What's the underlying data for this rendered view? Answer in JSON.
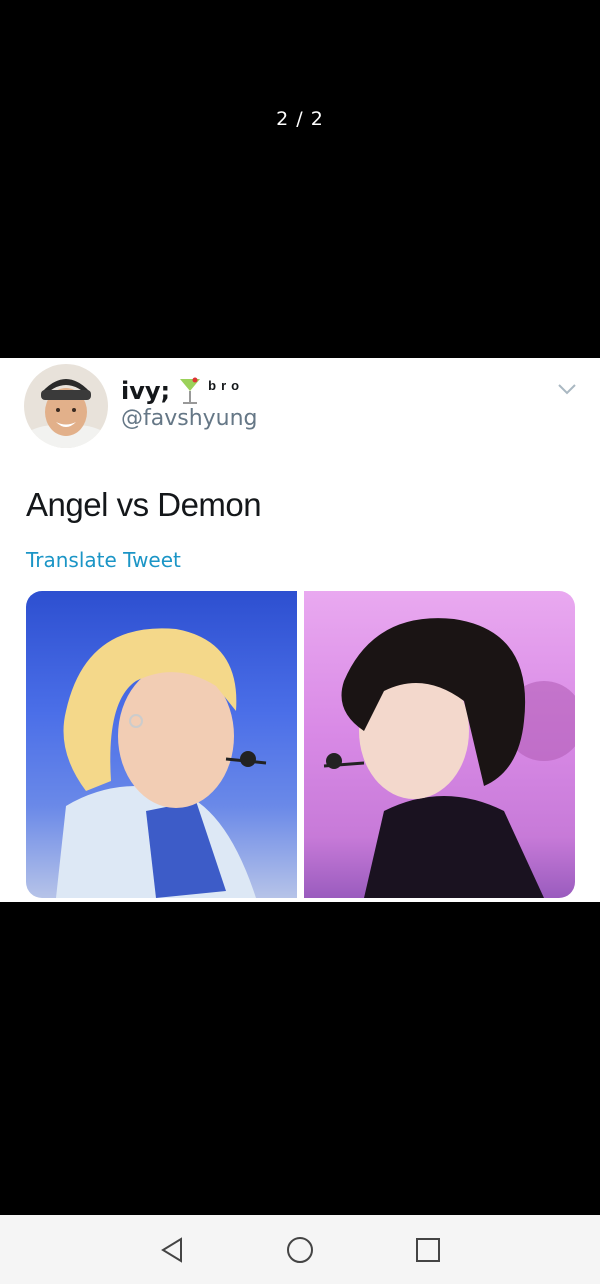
{
  "viewer": {
    "counter": "2 / 2"
  },
  "tweet": {
    "display_name": "ivy;",
    "name_suffix": "bro",
    "handle": "@favshyung",
    "text": "Angel vs Demon",
    "translate_label": "Translate Tweet",
    "icons": {
      "emoji": "cocktail-glass",
      "menu": "chevron-down"
    }
  },
  "colors": {
    "link": "#1b95c6",
    "handle": "#657786",
    "text": "#14171a"
  },
  "nav": {
    "back": "back-triangle",
    "home": "home-circle",
    "recents": "recents-square"
  }
}
